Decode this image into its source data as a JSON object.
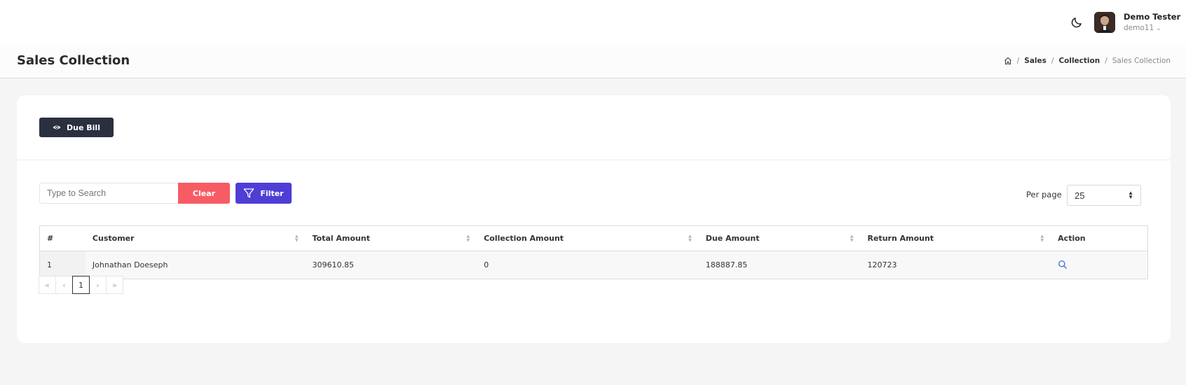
{
  "topbar": {
    "user_name": "Demo Tester",
    "user_handle": "demo11",
    "icons": {
      "theme": "moon-icon",
      "chevron": "chevron-down-icon"
    }
  },
  "header": {
    "title": "Sales Collection",
    "breadcrumb": [
      "Sales",
      "Collection",
      "Sales Collection"
    ]
  },
  "toolbar": {
    "due_bill_label": "Due Bill",
    "search_placeholder": "Type to Search",
    "clear_label": "Clear",
    "filter_label": "Filter",
    "per_page_label": "Per page",
    "per_page_value": "25"
  },
  "table": {
    "columns": [
      "#",
      "Customer",
      "Total Amount",
      "Collection Amount",
      "Due Amount",
      "Return Amount",
      "Action"
    ],
    "rows": [
      {
        "index": "1",
        "customer": "Johnathan Doeseph",
        "total": "309610.85",
        "collection": "0",
        "due": "188887.85",
        "return": "120723"
      }
    ]
  },
  "pagination": {
    "first": "«",
    "prev": "‹",
    "current": "1",
    "next": "›",
    "last": "»"
  },
  "colors": {
    "dark_button": "#2b3040",
    "clear_button": "#f75c65",
    "filter_button": "#4e3ed6",
    "action_icon": "#2f6fd6"
  }
}
